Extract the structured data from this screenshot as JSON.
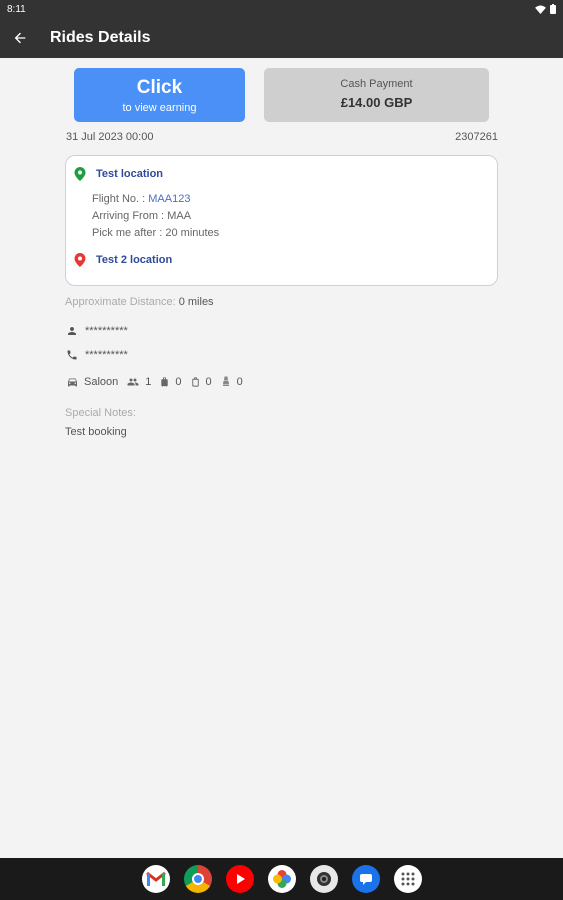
{
  "status_bar": {
    "time": "8:11"
  },
  "app_bar": {
    "title": "Rides Details"
  },
  "earning_button": {
    "title": "Click",
    "subtitle": "to view earning"
  },
  "payment": {
    "label": "Cash Payment",
    "amount": "£14.00 GBP"
  },
  "ride": {
    "datetime": "31 Jul 2023 00:00",
    "booking_id": "2307261"
  },
  "pickup": {
    "name": "Test location",
    "flight_label": "Flight No. : ",
    "flight_no": "MAA123",
    "arriving_label": "Arriving From : ",
    "arriving_from": "MAA",
    "pickup_label": "Pick me after : ",
    "pickup_after": "20 minutes"
  },
  "dropoff": {
    "name": "Test 2 location"
  },
  "distance": {
    "label": "Approximate Distance: ",
    "value": "0 miles"
  },
  "passenger": {
    "name": "**********",
    "phone": "**********"
  },
  "vehicle": {
    "type": "Saloon",
    "passengers": "1",
    "luggage": "0",
    "hand_luggage": "0",
    "child_seats": "0"
  },
  "notes": {
    "label": "Special Notes:",
    "text": "Test booking"
  },
  "colors": {
    "accent": "#4a90f7",
    "bars": "#333333",
    "pickup_pin": "#1e9e3e",
    "dropoff_pin": "#e53935",
    "location_text": "#2f4a9e"
  },
  "dock": [
    "gmail-icon",
    "chrome-icon",
    "youtube-icon",
    "photos-icon",
    "camera-icon",
    "messages-icon",
    "apps-icon"
  ]
}
